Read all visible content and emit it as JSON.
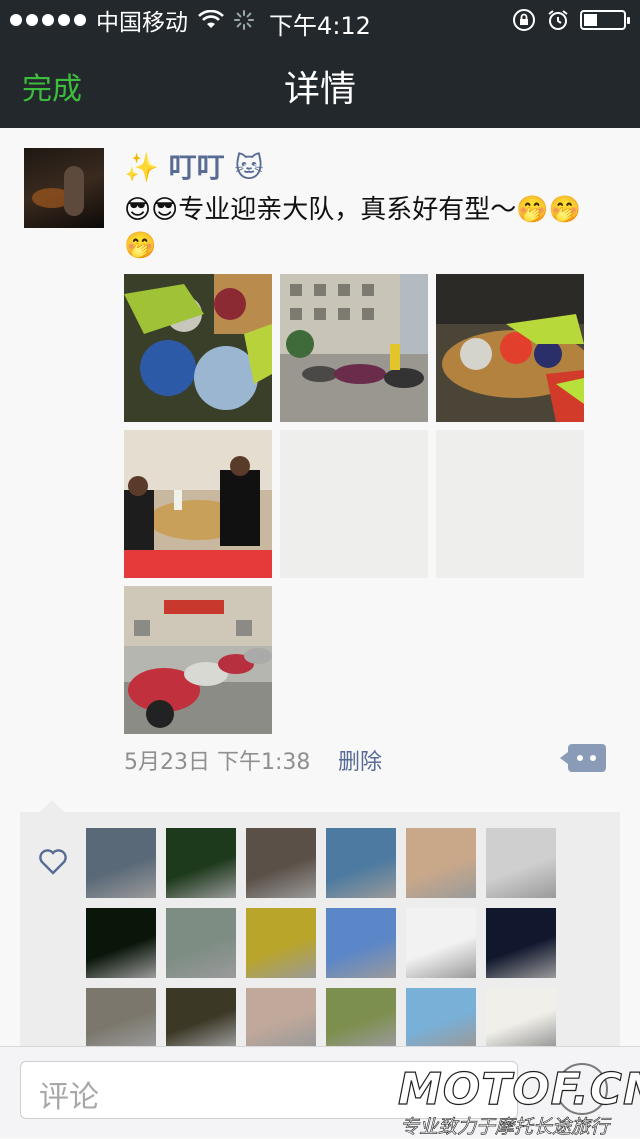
{
  "status_bar": {
    "carrier": "中国移动",
    "time": "下午4:12",
    "battery_level": 0.35
  },
  "nav": {
    "done_label": "完成",
    "title": "详情"
  },
  "post": {
    "username": "✨ 叮叮 🐱",
    "text": "😎😎专业迎亲大队，真系好有型～🤭🤭🤭",
    "date": "5月23日 下午1:38",
    "delete_label": "删除"
  },
  "photos": [
    {
      "name": "helmets-photo",
      "bg": "#3a3f2a"
    },
    {
      "name": "street-bikes-photo",
      "bg": "#8e8a84"
    },
    {
      "name": "workshop-helmets-photo",
      "bg": "#4b4538"
    },
    {
      "name": "restaurant-table-photo",
      "bg": "#b7a890"
    },
    {
      "name": "blank-photo-1",
      "bg": "#eeeeec"
    },
    {
      "name": "blank-photo-2",
      "bg": "#eeeeec"
    },
    {
      "name": "parked-bikes-photo",
      "bg": "#a06a6e"
    }
  ],
  "likes": {
    "icon": "heart-icon",
    "avatars": [
      "#5a6978",
      "#1e3a1c",
      "#5b5048",
      "#4c7aa0",
      "#c9a88a",
      "#cfcfcf",
      "#0a160a",
      "#7d8d84",
      "#b9a52a",
      "#5b86c8",
      "#f2f2f2",
      "#11182e",
      "#7b776c",
      "#3c3826",
      "#c0a89a",
      "#7d8f4e",
      "#78b0d8",
      "#f0efe9"
    ]
  },
  "comment": {
    "placeholder": "评论"
  },
  "watermark": {
    "logo": "MOTOF.CN",
    "tagline": "专业致力于摩托长途旅行"
  }
}
